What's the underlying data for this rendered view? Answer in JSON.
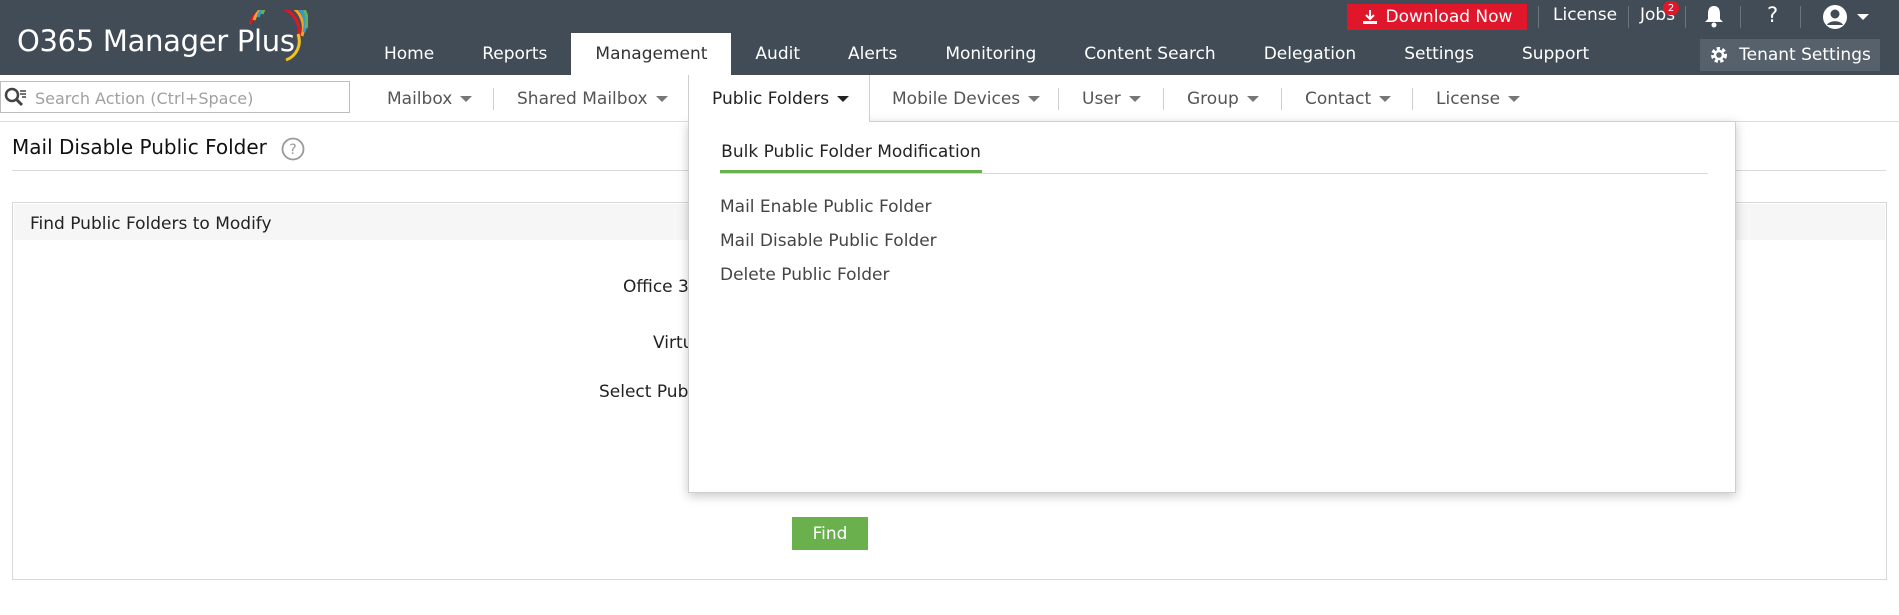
{
  "app": {
    "title": "O365 Manager Plus"
  },
  "top_actions": {
    "download_label": "Download Now",
    "license_label": "License",
    "jobs_label": "Jobs",
    "jobs_badge": "2",
    "help_label": "?"
  },
  "main_nav": [
    {
      "label": "Home"
    },
    {
      "label": "Reports"
    },
    {
      "label": "Management",
      "active": true
    },
    {
      "label": "Audit"
    },
    {
      "label": "Alerts"
    },
    {
      "label": "Monitoring"
    },
    {
      "label": "Content Search"
    },
    {
      "label": "Delegation"
    },
    {
      "label": "Settings"
    },
    {
      "label": "Support"
    }
  ],
  "tenant_settings_label": "Tenant Settings",
  "search": {
    "placeholder": "Search Action (Ctrl+Space)"
  },
  "sub_nav": [
    {
      "label": "Mailbox"
    },
    {
      "label": "Shared Mailbox"
    },
    {
      "label": "Public Folders",
      "active": true
    },
    {
      "label": "Mobile Devices"
    },
    {
      "label": "User"
    },
    {
      "label": "Group"
    },
    {
      "label": "Contact"
    },
    {
      "label": "License"
    }
  ],
  "page": {
    "title": "Mail Disable Public Folder",
    "panel_title": "Find Public Folders to Modify",
    "labels": [
      "Office 3",
      "Virtu",
      "Select Pub"
    ],
    "find_label": "Find"
  },
  "dropdown": {
    "tab_label": "Bulk Public Folder Modification",
    "items": [
      "Mail Enable Public Folder",
      "Mail Disable Public Folder",
      "Delete Public Folder"
    ]
  },
  "colors": {
    "topbar": "#414c56",
    "download_red": "#e0162b",
    "accent_green": "#6ab04c",
    "tenant_button": "#56616b"
  },
  "icons": {
    "download": "download-icon",
    "bell": "bell-icon",
    "user": "user-avatar-icon",
    "gear": "gear-icon",
    "search": "search-icon",
    "help": "help-circle-icon"
  }
}
